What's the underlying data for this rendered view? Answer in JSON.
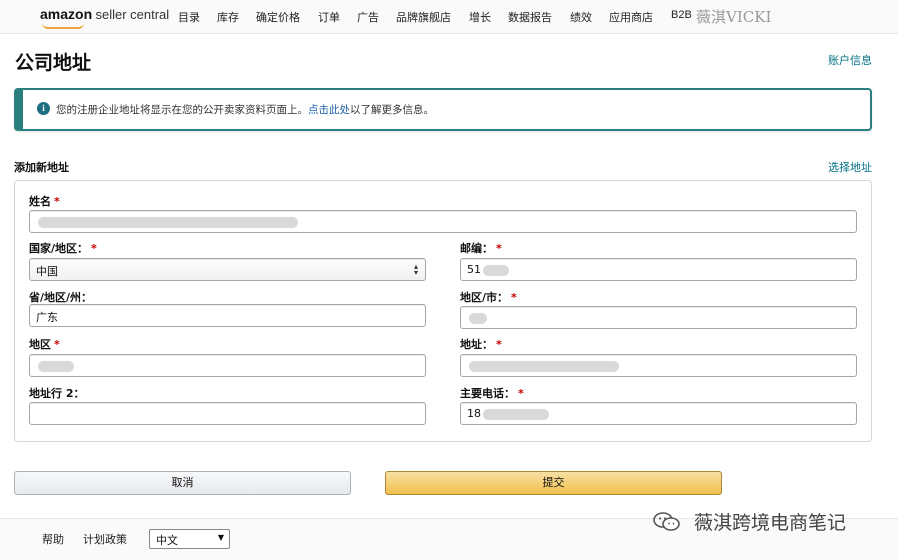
{
  "nav": {
    "logo_brand": "amazon",
    "logo_product": "seller central",
    "items": [
      "目录",
      "库存",
      "确定价格",
      "订单",
      "广告",
      "品牌旗舰店",
      "增长",
      "数据报告",
      "绩效",
      "应用商店"
    ],
    "b2b": "B2B",
    "watermark": "薇淇VICKI"
  },
  "page": {
    "title": "公司地址",
    "account_link": "账户信息"
  },
  "alert": {
    "text_before": "您的注册企业地址将显示在您的公开卖家资料页面上。",
    "link": "点击此处",
    "text_after": "以了解更多信息。"
  },
  "section": {
    "title": "添加新地址",
    "choose_link": "选择地址"
  },
  "form": {
    "name": {
      "label": "姓名",
      "required": "*",
      "value": ""
    },
    "country": {
      "label": "国家/地区：",
      "required": "*",
      "value": "中国"
    },
    "postcode": {
      "label": "邮编：",
      "required": "*",
      "value": "51"
    },
    "province": {
      "label": "省/地区/州：",
      "value": "广东"
    },
    "city": {
      "label": "地区/市：",
      "required": "*",
      "value": ""
    },
    "district": {
      "label": "地区",
      "required": "*",
      "value": ""
    },
    "address": {
      "label": "地址：",
      "required": "*",
      "value": ""
    },
    "address2": {
      "label": "地址行 2：",
      "value": ""
    },
    "phone": {
      "label": "主要电话：",
      "required": "*",
      "value": "18"
    }
  },
  "buttons": {
    "cancel": "取消",
    "submit": "提交"
  },
  "footer": {
    "help": "帮助",
    "policy": "计划政策",
    "language": "中文"
  },
  "watermark_bottom": "薇淇跨境电商笔记",
  "colors": {
    "alert_border": "#2a7f7f",
    "link": "#007185",
    "submit_button": "#f0c14b",
    "required": "#c40000"
  }
}
